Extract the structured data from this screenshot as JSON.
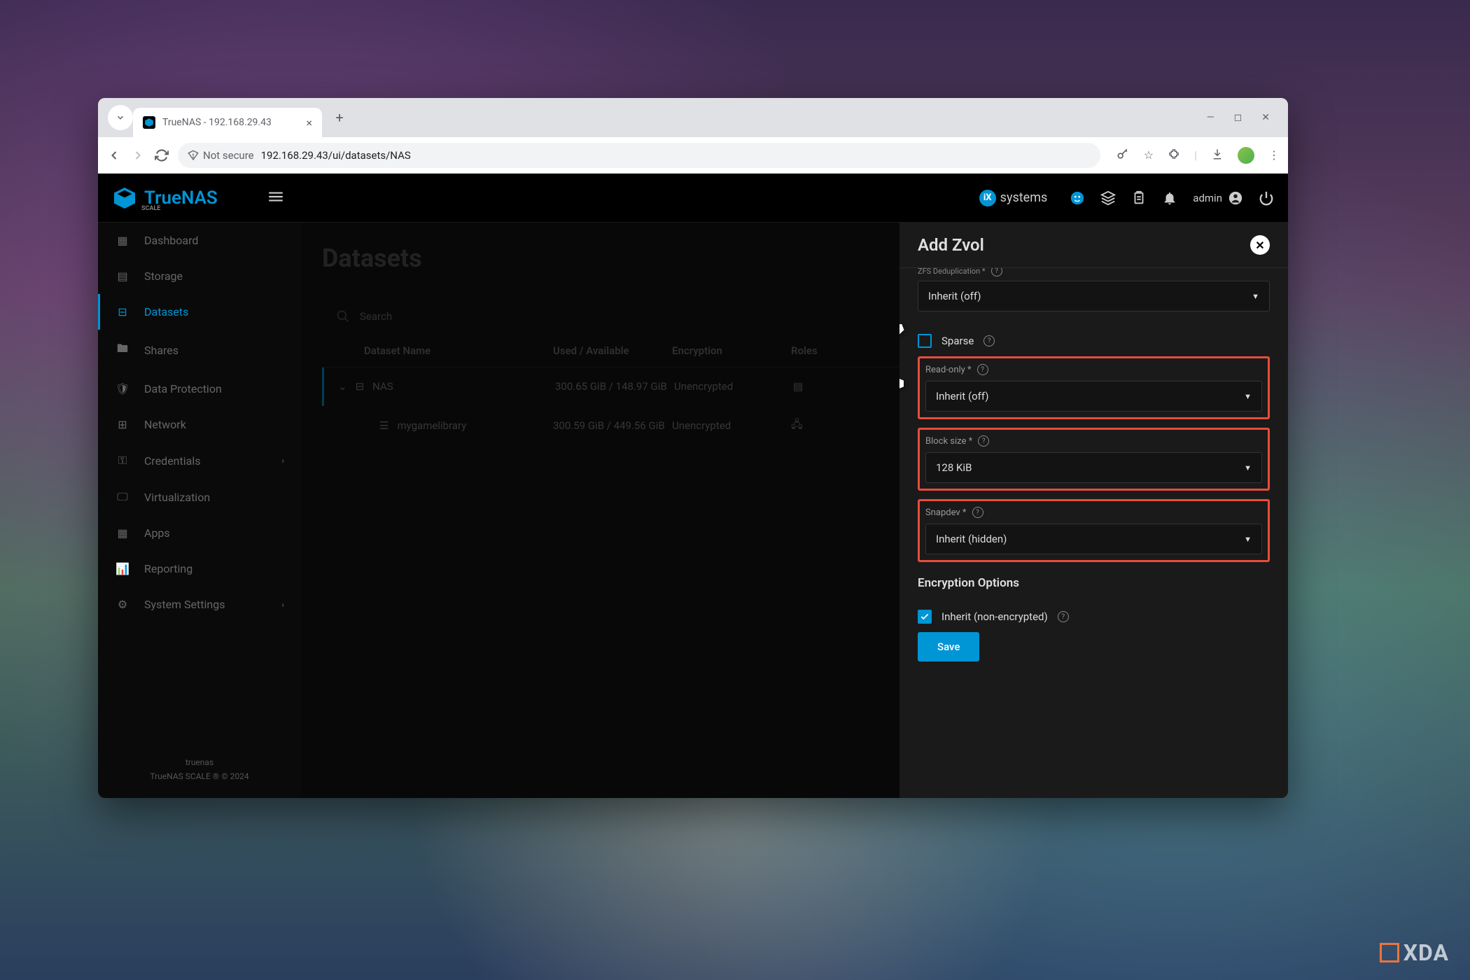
{
  "browser": {
    "tab_title": "TrueNAS - 192.168.29.43",
    "url": "192.168.29.43/ui/datasets/NAS",
    "security_label": "Not secure"
  },
  "header": {
    "brand": "TrueNAS",
    "brand_sub": "SCALE",
    "systems_label": "systems",
    "user": "admin"
  },
  "sidebar": {
    "items": [
      {
        "label": "Dashboard"
      },
      {
        "label": "Storage"
      },
      {
        "label": "Datasets"
      },
      {
        "label": "Shares"
      },
      {
        "label": "Data Protection"
      },
      {
        "label": "Network"
      },
      {
        "label": "Credentials"
      },
      {
        "label": "Virtualization"
      },
      {
        "label": "Apps"
      },
      {
        "label": "Reporting"
      },
      {
        "label": "System Settings"
      }
    ],
    "footer_host": "truenas",
    "footer_copy": "TrueNAS SCALE ® © 2024"
  },
  "main": {
    "title": "Datasets",
    "search_placeholder": "Search",
    "columns": {
      "name": "Dataset Name",
      "used": "Used / Available",
      "enc": "Encryption",
      "roles": "Roles"
    },
    "rows": [
      {
        "name": "NAS",
        "used": "300.65 GiB / 148.97 GiB",
        "enc": "Unencrypted"
      },
      {
        "name": "mygamelibrary",
        "used": "300.59 GiB / 449.56 GiB",
        "enc": "Unencrypted"
      }
    ]
  },
  "panel": {
    "title": "Add Zvol",
    "dedup_label": "ZFS Deduplication *",
    "dedup_value": "Inherit (off)",
    "sparse_label": "Sparse",
    "readonly_label": "Read-only *",
    "readonly_value": "Inherit (off)",
    "blocksize_label": "Block size *",
    "blocksize_value": "128 KiB",
    "snapdev_label": "Snapdev *",
    "snapdev_value": "Inherit (hidden)",
    "enc_section": "Encryption Options",
    "inherit_enc_label": "Inherit (non-encrypted)",
    "save_label": "Save"
  },
  "watermark": "XDA"
}
